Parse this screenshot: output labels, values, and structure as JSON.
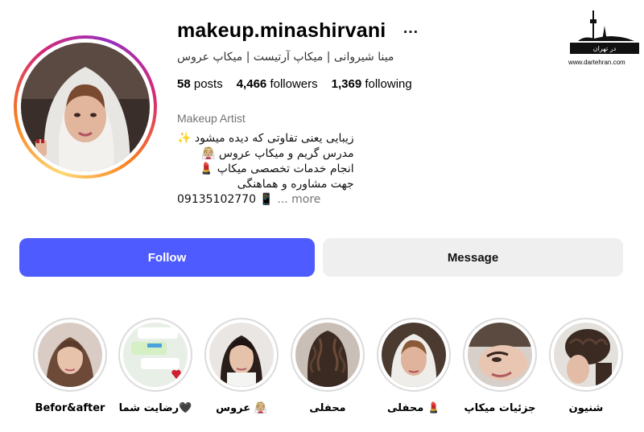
{
  "profile": {
    "username": "makeup.minashirvani",
    "more_icon": "…",
    "full_name": "مینا شیروانی | میکاپ آرتیست | میکاپ عروس",
    "stats": {
      "posts_count": "58",
      "posts_label": "posts",
      "followers_count": "4,466",
      "followers_label": "followers",
      "following_count": "1,369",
      "following_label": "following"
    },
    "category": "Makeup Artist",
    "bio": [
      "زیبایی یعنی تفاوتی که دیده میشود ✨",
      "مدرس گریم و میکاپ عروس 👰🏼",
      "انجام خدمات تخصصی میکاپ 💄",
      "جهت مشاوره و هماهنگی",
      "09135102770 📱"
    ],
    "more_link": "... more"
  },
  "actions": {
    "follow_label": "Follow",
    "message_label": "Message"
  },
  "watermark": {
    "url": "www.dartehran.com"
  },
  "highlights": [
    {
      "label": "Befor&after"
    },
    {
      "label": "رضایت شما🖤"
    },
    {
      "label": "عروس 👰🏼"
    },
    {
      "label": "محفلی"
    },
    {
      "label": "محفلی 💄"
    },
    {
      "label": "جزئیات میکاپ"
    },
    {
      "label": "شنیون"
    }
  ],
  "colors": {
    "follow_button": "#4d5bff",
    "message_button": "#efefef",
    "story_ring": [
      "#feda75",
      "#fa7e1e",
      "#d62976",
      "#962fbf"
    ]
  }
}
